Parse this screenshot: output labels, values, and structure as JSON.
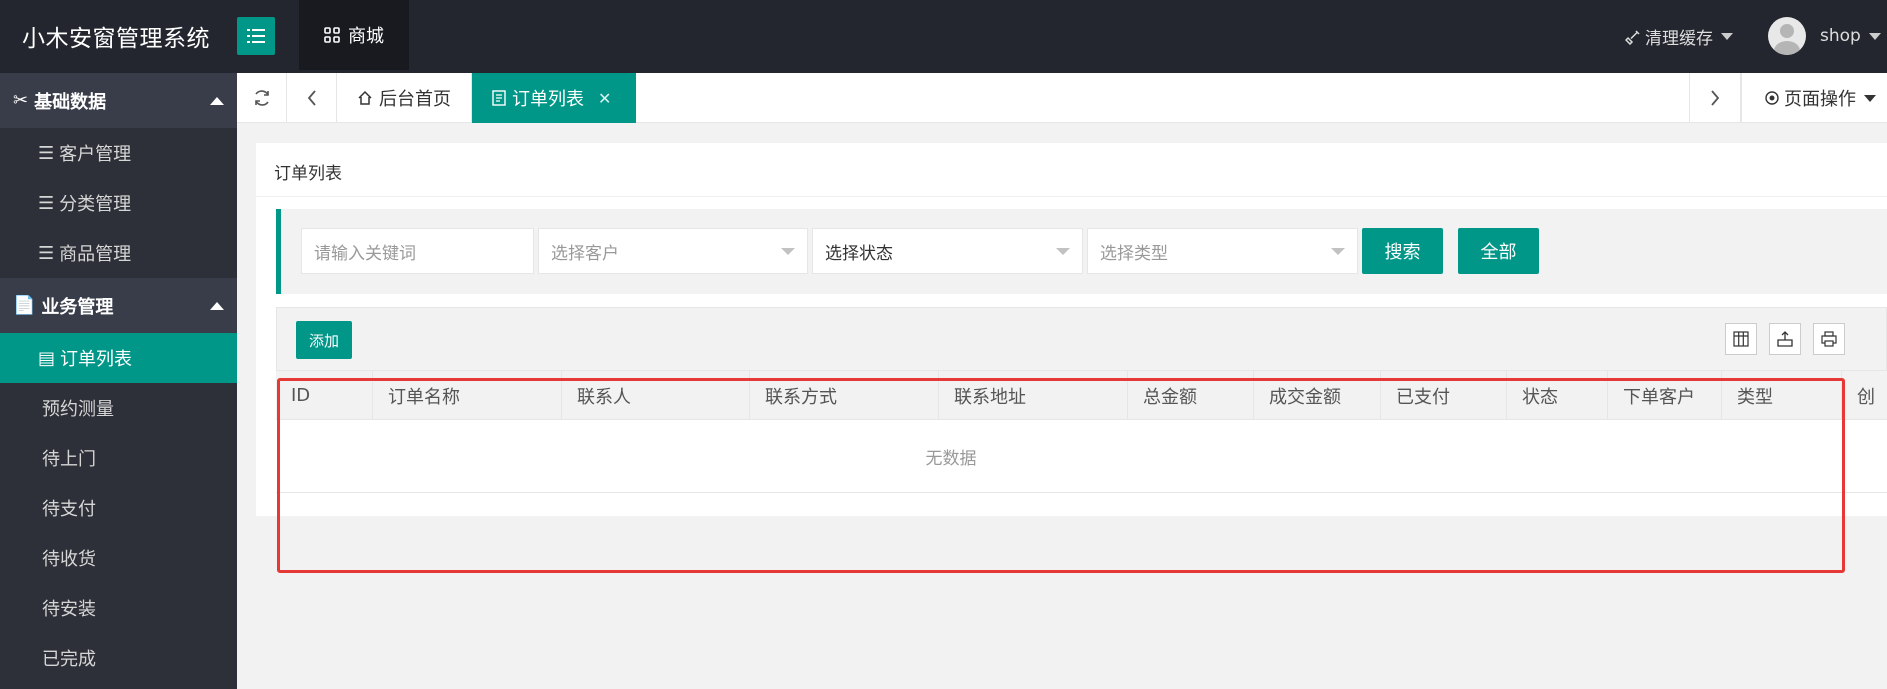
{
  "header": {
    "logo": "小木安窗管理系统",
    "top_tab": "商城",
    "clear_cache": "清理缓存",
    "username": "shop"
  },
  "sidebar": {
    "groups": [
      {
        "label": "基础数据",
        "items": [
          "客户管理",
          "分类管理",
          "商品管理"
        ]
      },
      {
        "label": "业务管理",
        "items": [
          "订单列表",
          "预约测量",
          "待上门",
          "待支付",
          "待收货",
          "待安装",
          "已完成"
        ]
      }
    ],
    "active": "订单列表"
  },
  "tabbar": {
    "home_tab": "后台首页",
    "current_tab": "订单列表",
    "page_ops": "页面操作"
  },
  "card": {
    "title": "订单列表"
  },
  "search": {
    "keyword_placeholder": "请输入关键词",
    "customer_placeholder": "选择客户",
    "status_value": "选择状态",
    "type_placeholder": "选择类型",
    "search_btn": "搜索",
    "all_btn": "全部"
  },
  "toolbar": {
    "add_btn": "添加"
  },
  "table": {
    "columns": [
      "ID",
      "订单名称",
      "联系人",
      "联系方式",
      "联系地址",
      "总金额",
      "成交金额",
      "已支付",
      "状态",
      "下单客户",
      "类型",
      "创"
    ],
    "empty_text": "无数据"
  },
  "colors": {
    "accent": "#009688",
    "header_bg": "#23262e",
    "sidebar_bg": "#2d3038",
    "highlight": "#e53935"
  }
}
